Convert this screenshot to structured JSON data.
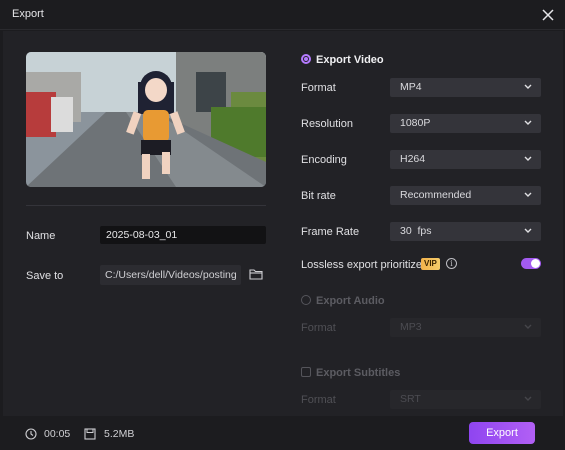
{
  "window": {
    "title": "Export"
  },
  "left": {
    "name_label": "Name",
    "name_value": "2025-08-03_01",
    "save_label": "Save to",
    "save_path": "C:/Users/dell/Videos/posting"
  },
  "video": {
    "section_label": "Export Video",
    "selected": true,
    "rows": [
      {
        "label": "Format",
        "value": "MP4"
      },
      {
        "label": "Resolution",
        "value": "1080P"
      },
      {
        "label": "Encoding",
        "value": "H264"
      },
      {
        "label": "Bit rate",
        "value": "Recommended"
      },
      {
        "label": "Frame Rate",
        "value": "30  fps"
      }
    ],
    "lossless_label": "Lossless export prioritized",
    "vip_badge": "VIP",
    "lossless_on": true
  },
  "audio": {
    "section_label": "Export Audio",
    "selected": false,
    "format_label": "Format",
    "format_value": "MP3"
  },
  "subtitles": {
    "section_label": "Export Subtitles",
    "checked": false,
    "format_label": "Format",
    "format_value": "SRT"
  },
  "footer": {
    "duration": "00:05",
    "size": "5.2MB",
    "export_label": "Export"
  },
  "colors": {
    "accent": "#a35bf0",
    "background": "#222226",
    "vip": "#f2b24b"
  }
}
